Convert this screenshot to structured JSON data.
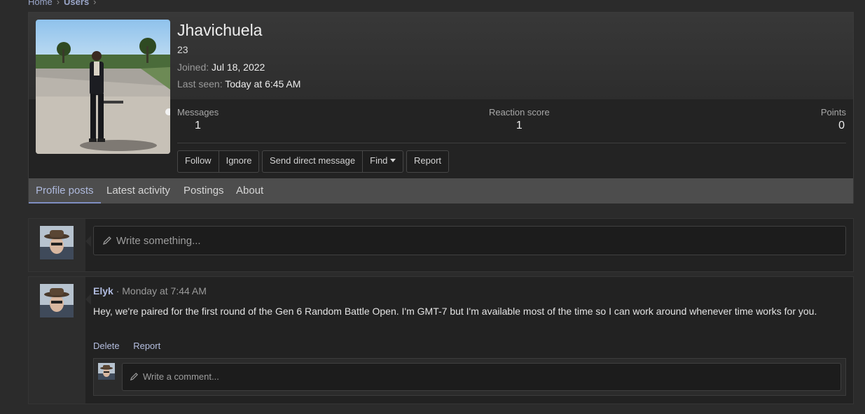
{
  "breadcrumb": {
    "items": [
      "Home",
      "Users"
    ]
  },
  "profile": {
    "username": "Jhavichuela",
    "user_title": "23",
    "joined_label": "Joined:",
    "joined_value": "Jul 18, 2022",
    "last_seen_label": "Last seen:",
    "last_seen_value": "Today at 6:45 AM",
    "stats": [
      {
        "label": "Messages",
        "value": "1"
      },
      {
        "label": "Reaction score",
        "value": "1"
      },
      {
        "label": "Points",
        "value": "0"
      }
    ],
    "buttons": {
      "follow": "Follow",
      "ignore": "Ignore",
      "send_dm": "Send direct message",
      "find": "Find",
      "report": "Report"
    },
    "tabs": [
      "Profile posts",
      "Latest activity",
      "Postings",
      "About"
    ]
  },
  "composer": {
    "placeholder": "Write something..."
  },
  "post": {
    "author": "Elyk",
    "separator": "·",
    "time": "Monday at 7:44 AM",
    "text": "Hey, we're paired for the first round of the Gen 6 Random Battle Open. I'm GMT-7 but I'm available most of the time so I can work around whenever time works for you.",
    "actions": {
      "delete": "Delete",
      "report": "Report"
    },
    "comment_placeholder": "Write a comment..."
  },
  "colors": {
    "accent": "#7f8ec2",
    "link": "#b0bbdf",
    "background": "#2b2b2b"
  }
}
